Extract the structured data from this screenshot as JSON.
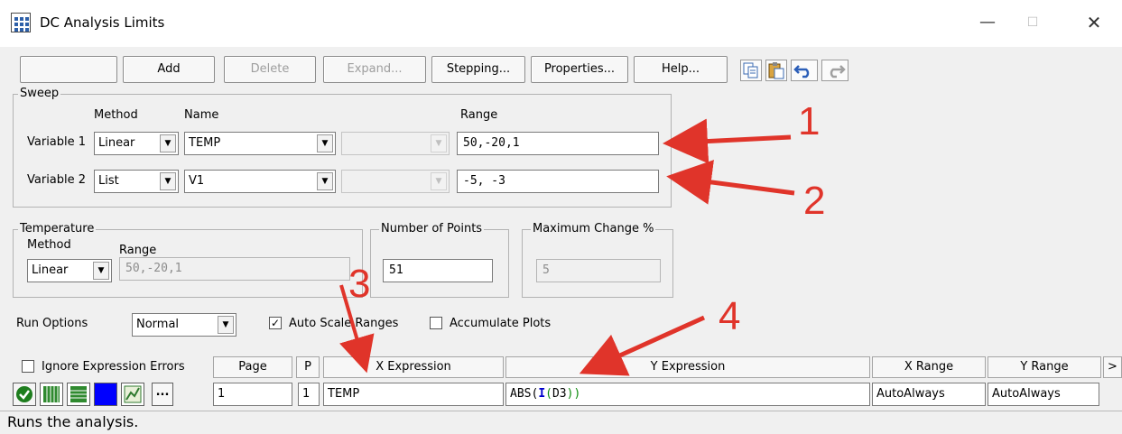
{
  "window": {
    "title": "DC Analysis Limits",
    "minimize": "—",
    "maximize": "☐",
    "close": "✕"
  },
  "toolbar": {
    "add": "Add",
    "delete": "Delete",
    "expand": "Expand...",
    "stepping": "Stepping...",
    "properties": "Properties...",
    "help": "Help...",
    "icons": [
      "copy-icon",
      "paste-icon",
      "undo-icon",
      "redo-icon"
    ]
  },
  "sweep": {
    "legend": "Sweep",
    "headers": {
      "method": "Method",
      "name": "Name",
      "range": "Range"
    },
    "variable1": {
      "label": "Variable 1",
      "method": "Linear",
      "name": "TEMP",
      "range": "50,-20,1"
    },
    "variable2": {
      "label": "Variable 2",
      "method": "List",
      "name": "V1",
      "range": "-5, -3"
    }
  },
  "temperature": {
    "legend": "Temperature",
    "method_label": "Method",
    "range_label": "Range",
    "method": "Linear",
    "range": "50,-20,1"
  },
  "points": {
    "legend": "Number of Points",
    "value": "51"
  },
  "max_change": {
    "legend": "Maximum Change %",
    "value": "5"
  },
  "run_options": {
    "label": "Run Options",
    "value": "Normal",
    "auto_scale_label": "Auto Scale Ranges",
    "auto_scale_checked": true,
    "accumulate_label": "Accumulate Plots",
    "accumulate_checked": false
  },
  "grid": {
    "ignore_errors_label": "Ignore Expression Errors",
    "headers": {
      "page": "Page",
      "p": "P",
      "x_expr": "X Expression",
      "y_expr": "Y Expression",
      "x_range": "X Range",
      "y_range": "Y Range",
      "more": ">"
    },
    "row": {
      "more_button": "...",
      "page": "1",
      "p": "1",
      "x_expr": "TEMP",
      "y_expr_prefix": "ABS(",
      "y_expr_inner": "I",
      "y_expr_paren_open": "(",
      "y_expr_arg": "D3",
      "y_expr_close": "))",
      "x_range": "AutoAlways",
      "y_range": "AutoAlways"
    }
  },
  "annotations": [
    "1",
    "2",
    "3",
    "4"
  ],
  "status": {
    "text": "Runs the analysis."
  },
  "colors": {
    "annotation": "#e0342a",
    "accent": "#0000ff",
    "green": "#1e7d1e"
  }
}
